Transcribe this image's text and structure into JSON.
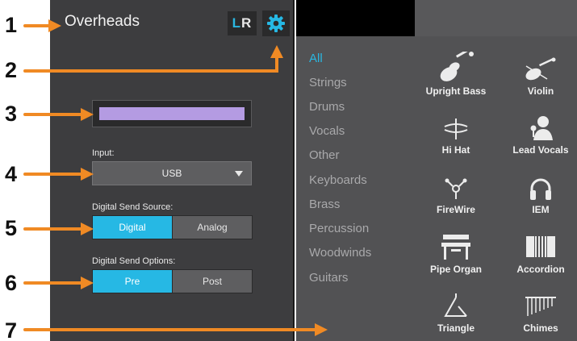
{
  "callouts": [
    "1",
    "2",
    "3",
    "4",
    "5",
    "6",
    "7"
  ],
  "channel": {
    "name": "Overheads",
    "lr_left": "L",
    "lr_right": "R",
    "color": "#b49be2"
  },
  "input": {
    "label": "Input:",
    "value": "USB"
  },
  "send_source": {
    "label": "Digital Send Source:",
    "options": [
      "Digital",
      "Analog"
    ],
    "selected": "Digital"
  },
  "send_options": {
    "label": "Digital Send Options:",
    "options": [
      "Pre",
      "Post"
    ],
    "selected": "Pre"
  },
  "categories": {
    "items": [
      "All",
      "Strings",
      "Drums",
      "Vocals",
      "Other",
      "Keyboards",
      "Brass",
      "Percussion",
      "Woodwinds",
      "Guitars"
    ],
    "selected": "All"
  },
  "presets": [
    {
      "label": "Upright Bass",
      "icon": "upright-bass-icon"
    },
    {
      "label": "Violin",
      "icon": "violin-icon"
    },
    {
      "label": "Hi Hat",
      "icon": "hi-hat-icon"
    },
    {
      "label": "Lead Vocals",
      "icon": "lead-vocals-icon"
    },
    {
      "label": "FireWire",
      "icon": "firewire-icon"
    },
    {
      "label": "IEM",
      "icon": "headphones-icon"
    },
    {
      "label": "Pipe Organ",
      "icon": "pipe-organ-icon"
    },
    {
      "label": "Accordion",
      "icon": "accordion-icon"
    },
    {
      "label": "Triangle",
      "icon": "triangle-icon"
    },
    {
      "label": "Chimes",
      "icon": "chimes-icon"
    }
  ],
  "colors": {
    "accent": "#26b8e4",
    "arrow": "#f08a24",
    "panel_dark": "#3d3d3f",
    "panel_right": "#525254"
  }
}
